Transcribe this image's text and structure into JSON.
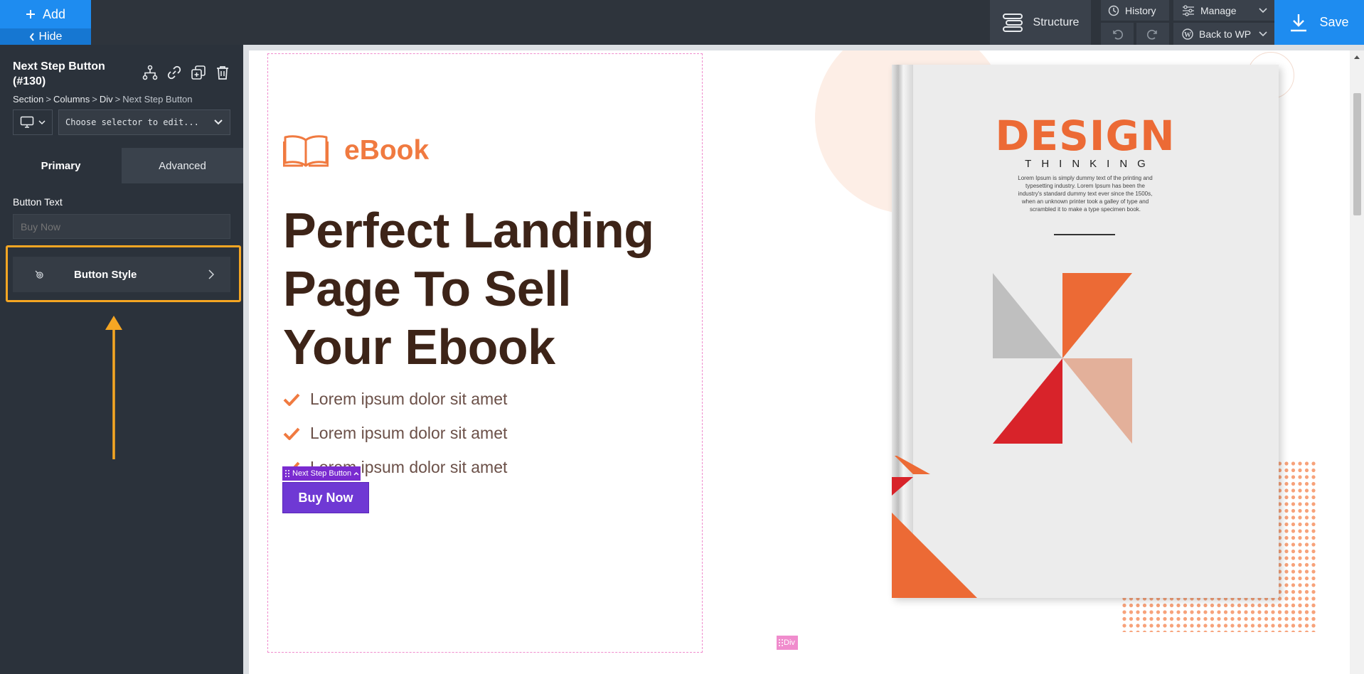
{
  "topbar": {
    "add_label": "Add",
    "hide_label": "Hide",
    "structure_label": "Structure",
    "history_label": "History",
    "manage_label": "Manage",
    "back_wp_label": "Back to WP",
    "save_label": "Save"
  },
  "panel": {
    "element_title": "Next Step Button (#130)",
    "breadcrumb": [
      "Section",
      "Columns",
      "Div",
      "Next Step Button"
    ],
    "device_icon": "desktop-icon",
    "selector_placeholder": "Choose selector to edit...",
    "tabs": [
      {
        "label": "Primary",
        "active": true
      },
      {
        "label": "Advanced",
        "active": false
      }
    ],
    "button_text_label": "Button Text",
    "button_text_placeholder": "Buy Now",
    "button_style_label": "Button Style"
  },
  "canvas": {
    "ebook_label": "eBook",
    "hero_title": "Perfect Landing Page To Sell Your Ebook",
    "features": [
      "Lorem ipsum dolor sit amet",
      "Lorem ipsum dolor sit amet",
      "Lorem ipsum dolor sit amet"
    ],
    "selected_tag": "Next Step Button",
    "buy_button_label": "Buy Now",
    "div_tag": "Div",
    "book": {
      "title": "DESIGN",
      "subtitle": "THINKING",
      "blurb": "Lorem Ipsum is simply dummy text of the printing and typesetting industry. Lorem Ipsum has been the industry's standard dummy text ever since the 1500s, when an unknown printer took a galley of type and scrambled it to make a type specimen book."
    }
  },
  "colors": {
    "accent_blue": "#1e8cf0",
    "highlight_orange": "#f5a623",
    "brand_orange": "#f07a40",
    "button_purple": "#6f39d4",
    "title_brown": "#3d2418"
  }
}
